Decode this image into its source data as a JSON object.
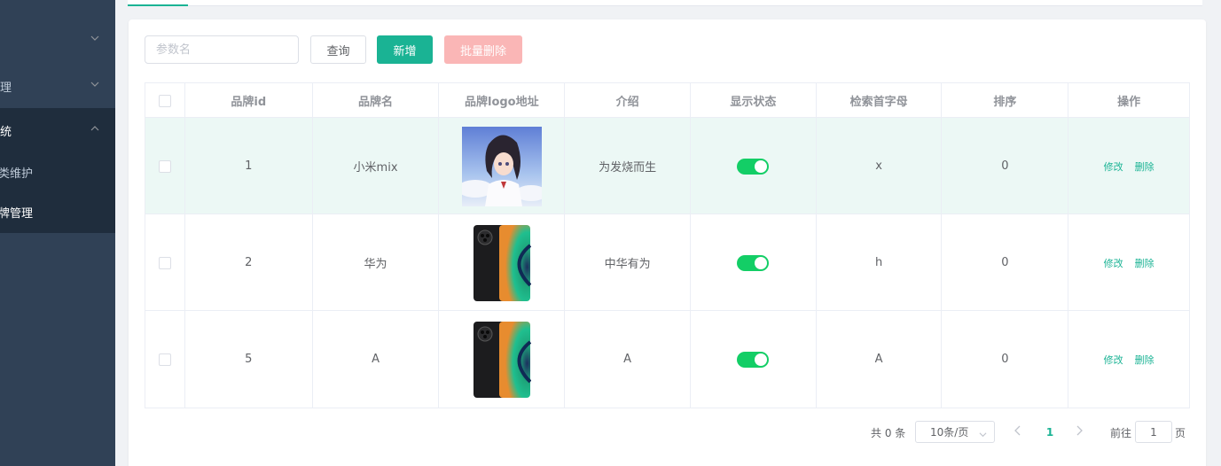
{
  "sidebar": {
    "items": [
      {
        "label": "",
        "chevron": "down"
      },
      {
        "label": "理",
        "chevron": "down"
      },
      {
        "label": "统",
        "chevron": "up"
      }
    ],
    "submenu": [
      {
        "label": "类维护",
        "active": false
      },
      {
        "label": "牌管理",
        "active": true
      }
    ]
  },
  "toolbar": {
    "search_placeholder": "参数名",
    "query_label": "查询",
    "add_label": "新增",
    "batch_delete_label": "批量删除"
  },
  "table": {
    "columns": [
      "品牌id",
      "品牌名",
      "品牌logo地址",
      "介绍",
      "显示状态",
      "检索首字母",
      "排序",
      "操作"
    ],
    "rows": [
      {
        "id": "1",
        "name": "小米mix",
        "logo": "anime-girl-image",
        "intro": "为发烧而生",
        "show_status": true,
        "first_letter": "x",
        "sort": "0",
        "highlighted": true
      },
      {
        "id": "2",
        "name": "华为",
        "logo": "phone-image",
        "intro": "中华有为",
        "show_status": true,
        "first_letter": "h",
        "sort": "0",
        "highlighted": false
      },
      {
        "id": "5",
        "name": "A",
        "logo": "phone-image",
        "intro": "A",
        "show_status": true,
        "first_letter": "A",
        "sort": "0",
        "highlighted": false
      }
    ],
    "edit_label": "修改",
    "delete_label": "删除"
  },
  "pagination": {
    "total_text": "共 0 条",
    "page_size": "10条/页",
    "current_page": "1",
    "goto_label": "前往",
    "goto_value": "1",
    "goto_suffix": "页"
  },
  "colors": {
    "accent": "#1ab394",
    "switch_on": "#13ce66",
    "danger_disabled": "#fab6b6",
    "sidebar_bg": "#304156",
    "row_highlight": "#ecf8f5"
  }
}
